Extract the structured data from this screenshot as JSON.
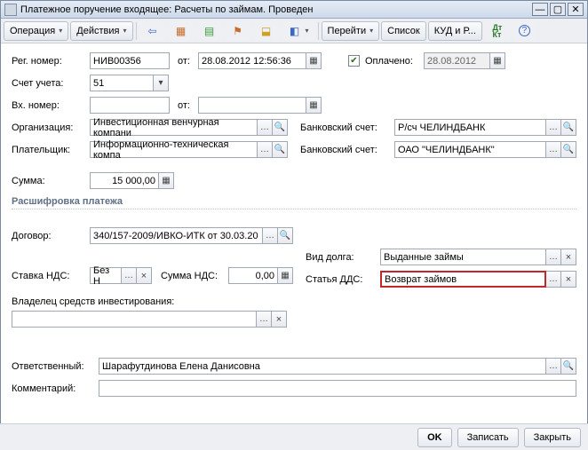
{
  "window": {
    "title": "Платежное поручение входящее: Расчеты по займам. Проведен"
  },
  "toolbar": {
    "operation": "Операция",
    "actions": "Действия",
    "goto": "Перейти",
    "list": "Список",
    "kudir": "КУД и Р...",
    "dtkt": "Дт Кт"
  },
  "fields": {
    "reg_number_label": "Рег. номер:",
    "reg_number": "НИВ00356",
    "from_label": "от:",
    "date_time": "28.08.2012 12:56:36",
    "paid_label": "Оплачено:",
    "paid_date": "28.08.2012",
    "account_label": "Счет учета:",
    "account": "51",
    "in_number_label": "Вх. номер:",
    "in_number": "",
    "in_date": "",
    "org_label": "Организация:",
    "org": "Инвестиционная венчурная компани",
    "bank_acc_label": "Банковский счет:",
    "bank_acc_org": "Р/сч ЧЕЛИНДБАНК",
    "payer_label": "Плательщик:",
    "payer": "Информационно-техническая компа",
    "bank_acc_payer": "ОАО \"ЧЕЛИНДБАНК\"",
    "sum_label": "Сумма:",
    "sum": "15 000,00",
    "decode_title": "Расшифровка платежа",
    "contract_label": "Договор:",
    "contract": "340/157-2009/ИВКО-ИТК от 30.03.20",
    "debt_type_label": "Вид долга:",
    "debt_type": "Выданные займы",
    "vat_rate_label": "Ставка НДС:",
    "vat_rate": "Без Н",
    "vat_sum_label": "Сумма НДС:",
    "vat_sum": "0,00",
    "dds_label": "Статья ДДС:",
    "dds": "Возврат займов",
    "owner_label": "Владелец средств инвестирования:",
    "owner": "",
    "responsible_label": "Ответственный:",
    "responsible": "Шарафутдинова Елена Данисовна",
    "comment_label": "Комментарий:",
    "comment": ""
  },
  "footer": {
    "ok": "OK",
    "save": "Записать",
    "close": "Закрыть"
  }
}
